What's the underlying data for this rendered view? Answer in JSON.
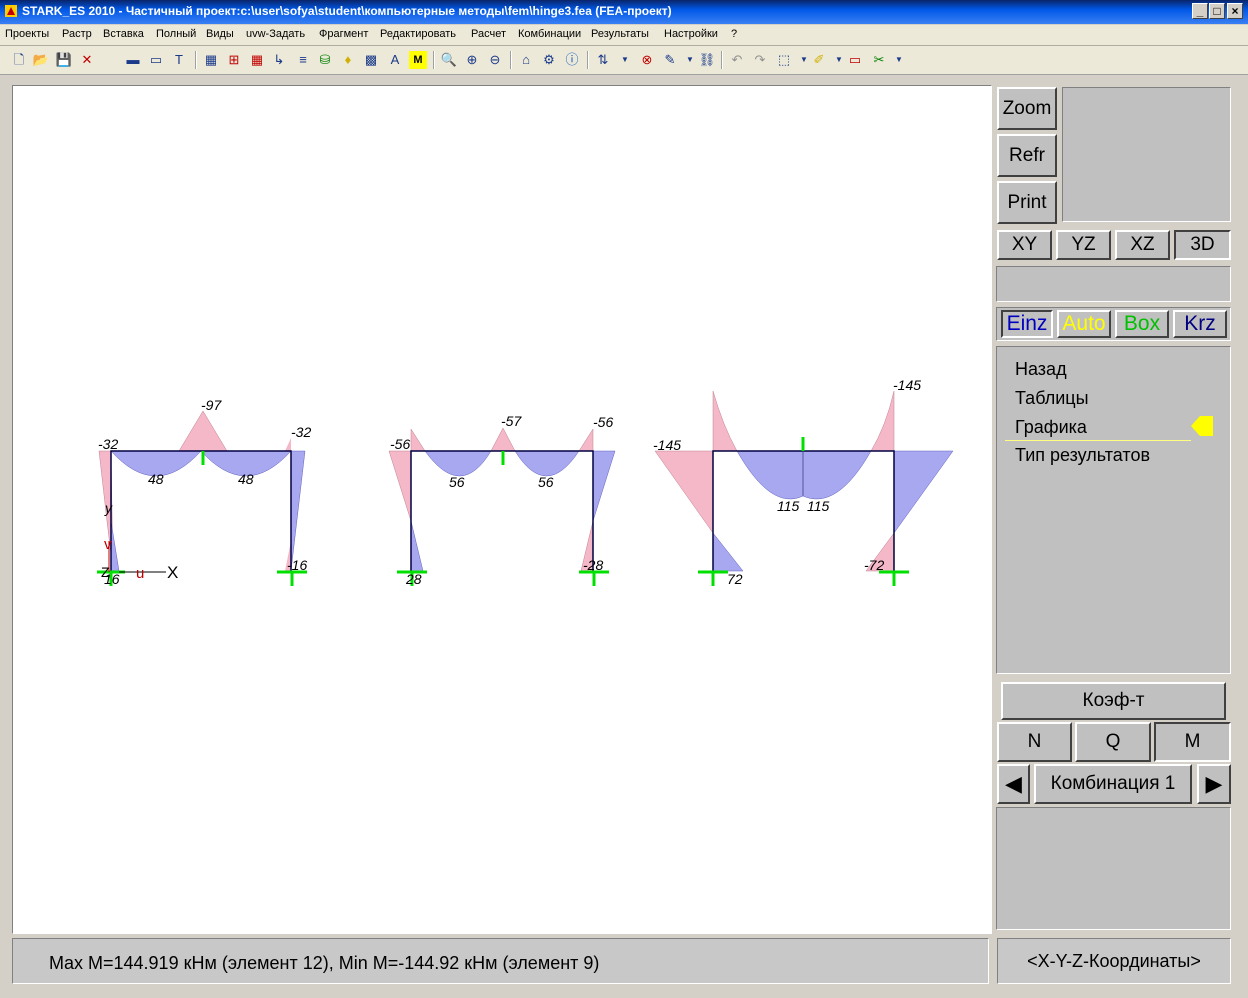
{
  "window": {
    "title": "STARK_ES 2010 - Частичный проект:c:\\user\\sofya\\student\\компьютерные методы\\fem\\hinge3.fea  (FEA-проект)",
    "controls": [
      "_",
      "□",
      "×"
    ]
  },
  "menu": [
    "Проекты",
    "Растр",
    "Вставка",
    "Полный",
    "Виды",
    "uvw-Задать",
    "Фрагмент",
    "Редактировать",
    "Расчет",
    "Комбинации",
    "Результаты",
    "Настройки",
    "?"
  ],
  "toolbar_icons": [
    "new-icon",
    "open-icon",
    "save-icon",
    "delete-icon",
    "display-icon",
    "display2-icon",
    "text-icon",
    "grid-icon",
    "grid2-icon",
    "grid3-icon",
    "axes-icon",
    "layers-icon",
    "db-icon",
    "bulb-icon",
    "pattern-icon",
    "ab-icon",
    "m-icon",
    "zoom-icon",
    "zoom-in-icon",
    "zoom-out-icon",
    "home-icon",
    "settings-icon",
    "info-icon",
    "mf-icon",
    "stop-icon",
    "edit-icon",
    "chain-icon",
    "undo-icon",
    "redo-icon",
    "3d-icon",
    "pen-icon",
    "ruler-icon",
    "paint-icon"
  ],
  "right_panel": {
    "zoom": "Zoom",
    "refr": "Refr",
    "print": "Print",
    "views": [
      "XY",
      "YZ",
      "XZ",
      "3D"
    ],
    "modes": [
      {
        "label": "Einz",
        "color": "#0000c0"
      },
      {
        "label": "Auto",
        "color": "#ffff00"
      },
      {
        "label": "Box",
        "color": "#00c000"
      },
      {
        "label": "Krz",
        "color": "#000080"
      }
    ],
    "nav": [
      "Назад",
      "Таблицы",
      "Графика",
      "Тип результатов"
    ],
    "nav_active": "Графика",
    "coef": "Коэф-т",
    "forces": [
      "N",
      "Q",
      "M"
    ],
    "combination": "Комбинация 1",
    "prev": "◀",
    "next": "▶"
  },
  "status": {
    "text": "Max M=144.919 кНм (элемент 12), Min M=-144.92 кНм (элемент 9)",
    "coords": "<X-Y-Z-Координаты>"
  },
  "diagram": {
    "colors": {
      "negative": "#f4b8c8",
      "positive": "#a8a8f0",
      "support": "#00e000",
      "frame": "#000040"
    },
    "frame1": {
      "labels": [
        "-32",
        "-97",
        "-32",
        "48",
        "48",
        "-16",
        "16"
      ]
    },
    "frame2": {
      "labels": [
        "-56",
        "-57",
        "-56",
        "56",
        "56",
        "28",
        "-28"
      ]
    },
    "frame3": {
      "labels": [
        "-145",
        "-145",
        "115",
        "115",
        "72",
        "-72"
      ]
    },
    "axes": {
      "x": "X",
      "u": "u",
      "y": "y",
      "v": "v",
      "z": "Z"
    }
  }
}
